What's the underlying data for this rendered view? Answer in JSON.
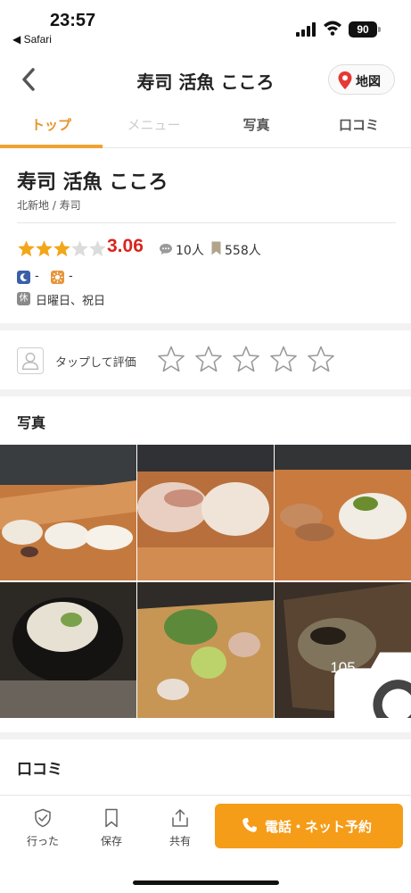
{
  "status_bar": {
    "time": "23:57",
    "back_app": "◀ Safari",
    "battery": "90"
  },
  "nav": {
    "title": "寿司 活魚 こころ",
    "map_label": "地図"
  },
  "tabs": [
    {
      "label": "トップ",
      "state": "active"
    },
    {
      "label": "メニュー",
      "state": "disabled"
    },
    {
      "label": "写真",
      "state": "normal"
    },
    {
      "label": "口コミ",
      "state": "normal"
    }
  ],
  "shop": {
    "name": "寿司 活魚 こころ",
    "genre": "北新地 / 寿司",
    "rating": "3.06",
    "stars_filled": 3,
    "stars_total": 5,
    "review_count": "10人",
    "save_count": "558人",
    "dinner_budget": "-",
    "lunch_budget": "-",
    "holiday_badge": "休",
    "holidays": "日曜日、祝日"
  },
  "rate": {
    "label": "タップして評価",
    "stars": 5
  },
  "photos": {
    "title": "写真",
    "more_count": "105"
  },
  "reviews": {
    "title": "口コミ"
  },
  "bottom_bar": {
    "visited": "行った",
    "save": "保存",
    "share": "共有",
    "reserve": "電話・ネット予約"
  },
  "colors": {
    "accent": "#f0a234",
    "rating": "#d7261e",
    "button": "#f59c18"
  }
}
